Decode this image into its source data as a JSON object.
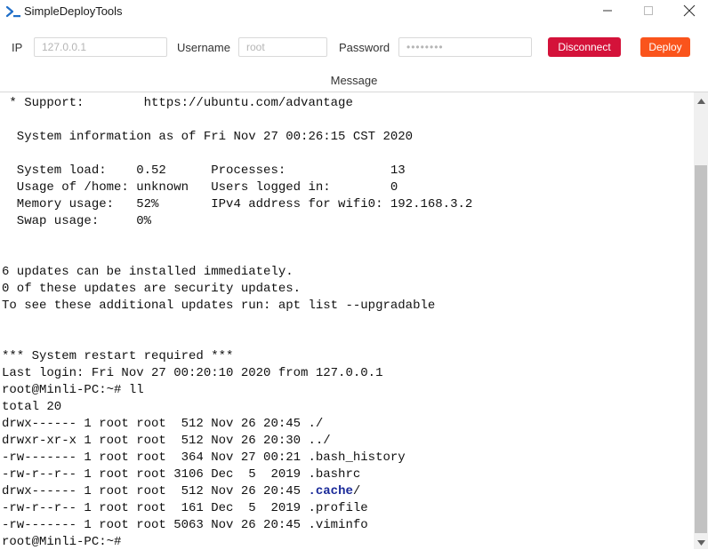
{
  "window": {
    "title": "SimpleDeployTools",
    "icon": "terminal-prompt-icon",
    "accent": "#1e6ec8",
    "controls": [
      "minimize-icon",
      "maximize-icon",
      "close-icon"
    ]
  },
  "connection": {
    "ip_label": "IP",
    "ip_value": "127.0.0.1",
    "username_label": "Username",
    "username_value": "root",
    "password_label": "Password",
    "password_value": "••••••••",
    "disconnect_label": "Disconnect",
    "deploy_label": "Deploy",
    "disconnect_color": "#d4123a",
    "deploy_color": "#fa541c"
  },
  "message": {
    "label": "Message"
  },
  "terminal": {
    "lines": [
      " * Support:        https://ubuntu.com/advantage",
      "",
      "  System information as of Fri Nov 27 00:26:15 CST 2020",
      "",
      "  System load:    0.52      Processes:              13",
      "  Usage of /home: unknown   Users logged in:        0",
      "  Memory usage:   52%       IPv4 address for wifi0: 192.168.3.2",
      "  Swap usage:     0%",
      "",
      "",
      "6 updates can be installed immediately.",
      "0 of these updates are security updates.",
      "To see these additional updates run: apt list --upgradable",
      "",
      "",
      "*** System restart required ***",
      "Last login: Fri Nov 27 00:20:10 2020 from 127.0.0.1",
      "root@Minli-PC:~# ll",
      "total 20",
      "drwx------ 1 root root  512 Nov 26 20:45 ./",
      "drwxr-xr-x 1 root root  512 Nov 26 20:30 ../",
      "-rw------- 1 root root  364 Nov 27 00:21 .bash_history",
      "-rw-r--r-- 1 root root 3106 Dec  5  2019 .bashrc",
      "drwx------ 1 root root  512 Nov 26 20:45 ",
      "-rw-r--r-- 1 root root  161 Dec  5  2019 .profile",
      "-rw------- 1 root root 5063 Nov 26 20:45 .viminfo",
      "root@Minli-PC:~#"
    ],
    "highlight_dir": ".cache",
    "highlight_suffix": "/",
    "highlight_color": "#1a2a99"
  }
}
